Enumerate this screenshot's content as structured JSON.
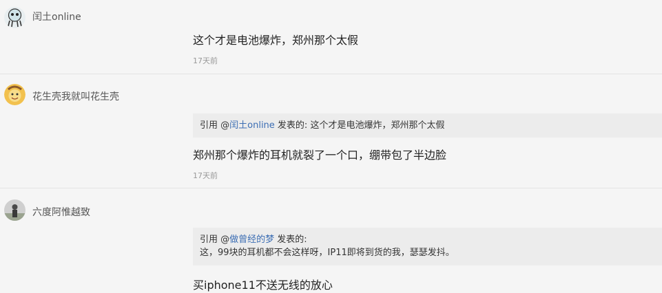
{
  "comments": [
    {
      "username": "闰土online",
      "avatar_icon": "squid-cartoon-avatar",
      "text": "这个才是电池爆炸，郑州那个太假",
      "time": "17天前"
    },
    {
      "username": "花生壳我就叫花生壳",
      "avatar_icon": "cartoon-face-avatar",
      "quote": {
        "prefix": "引用 @",
        "user": "闰土online",
        "suffix": " 发表的: 这个才是电池爆炸，郑州那个太假"
      },
      "text": "郑州那个爆炸的耳机就裂了一个口，绷带包了半边脸",
      "time": "17天前"
    },
    {
      "username": "六度阿惟越致",
      "avatar_icon": "person-photo-avatar",
      "quote": {
        "prefix": "引用 @",
        "user": "做曾经的梦",
        "suffix": " 发表的:",
        "line2": "这，99块的耳机都不会这样呀，IP11即将到货的我，瑟瑟发抖。"
      },
      "text": "买iphone11不送无线的放心"
    }
  ]
}
